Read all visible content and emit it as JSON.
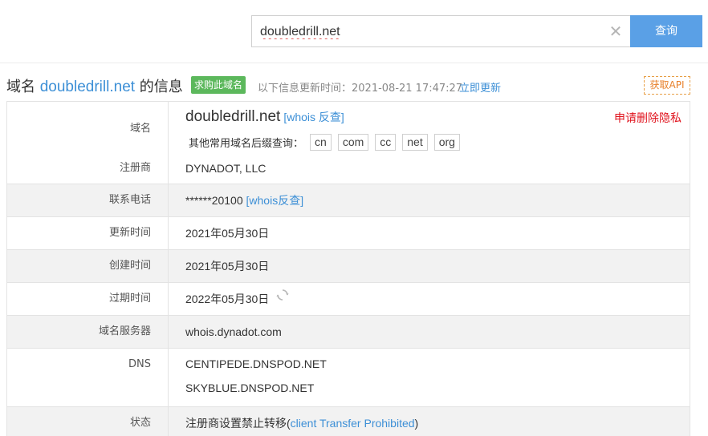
{
  "search": {
    "value": "doubledrill.net",
    "button_label": "查询"
  },
  "title": {
    "prefix": "域名",
    "domain": "doubledrill.net",
    "suffix": "的信息",
    "buy_badge": "求购此域名",
    "update_text": "以下信息更新时间：2021-08-21 17:47:27",
    "update_link": "立即更新",
    "api_button": "获取API"
  },
  "info": {
    "domain": {
      "label": "域名",
      "value": "doubledrill.net",
      "reverse_link": "[whois 反查]",
      "delete_privacy": "申请删除隐私",
      "suffix_label": "其他常用域名后缀查询：",
      "suffixes": [
        "cn",
        "com",
        "cc",
        "net",
        "org"
      ]
    },
    "registrar": {
      "label": "注册商",
      "value": "DYNADOT, LLC"
    },
    "phone": {
      "label": "联系电话",
      "value": "******20100",
      "reverse_link": "[whois反查]"
    },
    "updated": {
      "label": "更新时间",
      "value": "2021年05月30日"
    },
    "created": {
      "label": "创建时间",
      "value": "2021年05月30日"
    },
    "expires": {
      "label": "过期时间",
      "value": "2022年05月30日"
    },
    "whois_server": {
      "label": "域名服务器",
      "value": "whois.dynadot.com"
    },
    "dns": {
      "label": "DNS",
      "values": [
        "CENTIPEDE.DNSPOD.NET",
        "SKYBLUE.DNSPOD.NET"
      ]
    },
    "status": {
      "label": "状态",
      "text": "注册商设置禁止转移(",
      "link": "client Transfer Prohibited",
      "close": ")"
    }
  },
  "colors": {
    "link": "#3c8fd6",
    "search_button": "#5aa0e6",
    "buy_badge": "#5cb85c",
    "delete_privacy": "#e0141e",
    "api_border": "#e8a048"
  },
  "icons": [
    "clear-icon",
    "refresh-icon"
  ]
}
